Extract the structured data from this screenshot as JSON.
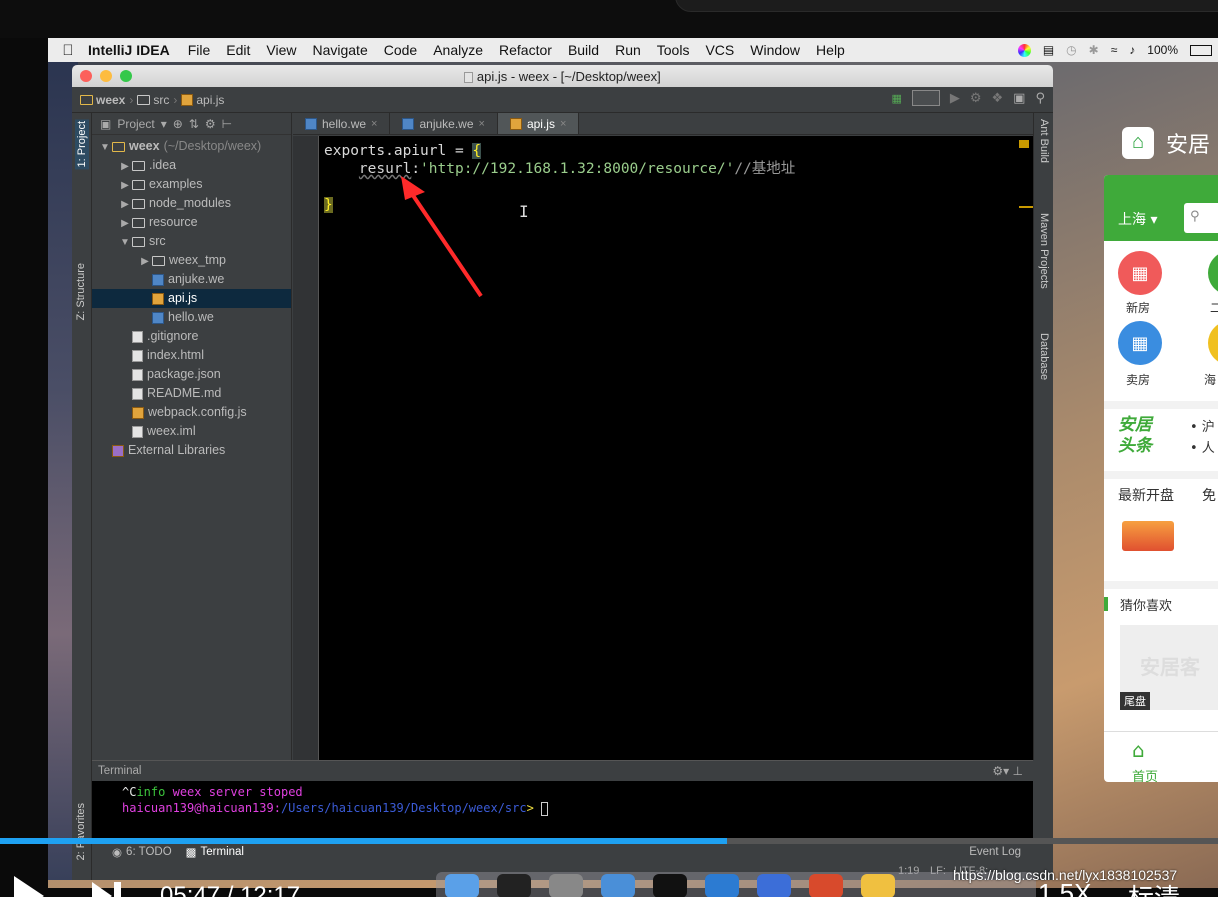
{
  "menubar": {
    "app": "IntelliJ IDEA",
    "items": [
      "File",
      "Edit",
      "View",
      "Navigate",
      "Code",
      "Analyze",
      "Refactor",
      "Build",
      "Run",
      "Tools",
      "VCS",
      "Window",
      "Help"
    ],
    "battery": "100%"
  },
  "window": {
    "title": "api.js - weex - [~/Desktop/weex]",
    "breadcrumbs": [
      "weex",
      "src",
      "api.js"
    ]
  },
  "project_panel": {
    "header": "Project",
    "tree": [
      {
        "label": "weex",
        "extra": "(~/Desktop/weex)",
        "level": 0,
        "kind": "folder",
        "expanded": true
      },
      {
        "label": ".idea",
        "level": 1,
        "kind": "folder",
        "expanded": false
      },
      {
        "label": "examples",
        "level": 1,
        "kind": "folder",
        "expanded": false
      },
      {
        "label": "node_modules",
        "level": 1,
        "kind": "folder",
        "expanded": false
      },
      {
        "label": "resource",
        "level": 1,
        "kind": "folder",
        "expanded": false
      },
      {
        "label": "src",
        "level": 1,
        "kind": "folder",
        "expanded": true
      },
      {
        "label": "weex_tmp",
        "level": 2,
        "kind": "folder",
        "expanded": false
      },
      {
        "label": "anjuke.we",
        "level": 2,
        "kind": "we"
      },
      {
        "label": "api.js",
        "level": 2,
        "kind": "js",
        "selected": true
      },
      {
        "label": "hello.we",
        "level": 2,
        "kind": "we"
      },
      {
        "label": ".gitignore",
        "level": 1,
        "kind": "file"
      },
      {
        "label": "index.html",
        "level": 1,
        "kind": "file"
      },
      {
        "label": "package.json",
        "level": 1,
        "kind": "file"
      },
      {
        "label": "README.md",
        "level": 1,
        "kind": "file"
      },
      {
        "label": "webpack.config.js",
        "level": 1,
        "kind": "js"
      },
      {
        "label": "weex.iml",
        "level": 1,
        "kind": "file"
      },
      {
        "label": "External Libraries",
        "level": 0,
        "kind": "lib"
      }
    ]
  },
  "left_stripe": {
    "project": "1: Project",
    "structure": "Z: Structure",
    "favorites": "2: Favorites"
  },
  "right_stripe": {
    "ant": "Ant Build",
    "maven": "Maven Projects",
    "database": "Database"
  },
  "tabs": [
    {
      "label": "hello.we",
      "kind": "we"
    },
    {
      "label": "anjuke.we",
      "kind": "we"
    },
    {
      "label": "api.js",
      "kind": "js",
      "active": true
    }
  ],
  "editor": {
    "line1_a": "exports.apiurl = ",
    "line1_brace": "{",
    "line2_field": "resurl",
    "line2_colon": ":",
    "line2_string": "'http://192.168.1.32:8000/resource/'",
    "line2_comment": "//基地址",
    "line4_brace": "}"
  },
  "terminal": {
    "title": "Terminal",
    "line1_ctrl": "^C",
    "line1_info": "info",
    "line1_weex": "weex",
    "line1_msg": "server stoped",
    "prompt_user": "haicuan139@haicuan139:",
    "prompt_path": "/Users/haicuan139/Desktop/weex/src",
    "prompt_sym": ">"
  },
  "bottom_tabs": {
    "todo": "6: TODO",
    "terminal": "Terminal",
    "event_log": "Event Log"
  },
  "status_bar": {
    "pos": "1:19",
    "lf": "LF:",
    "enc": "UTF-8:"
  },
  "phone": {
    "app_name": "安居",
    "city": "上海",
    "grid_labels": [
      "新房",
      "二",
      "卖房",
      "海"
    ],
    "brand_l1": "安居",
    "brand_l2": "头条",
    "news": [
      "• 沪",
      "• 人"
    ],
    "new_open": "最新开盘",
    "new_open_2": "免",
    "guess": "猜你喜欢",
    "card_wm": "安居客",
    "card_tag": "尾盘",
    "nav_home": "首页"
  },
  "player": {
    "time": "05:47 / 12:17",
    "speed": "1.5X",
    "quality": "标清",
    "progress": 0.597
  },
  "watermark": "https://blog.csdn.net/lyx1838102537"
}
